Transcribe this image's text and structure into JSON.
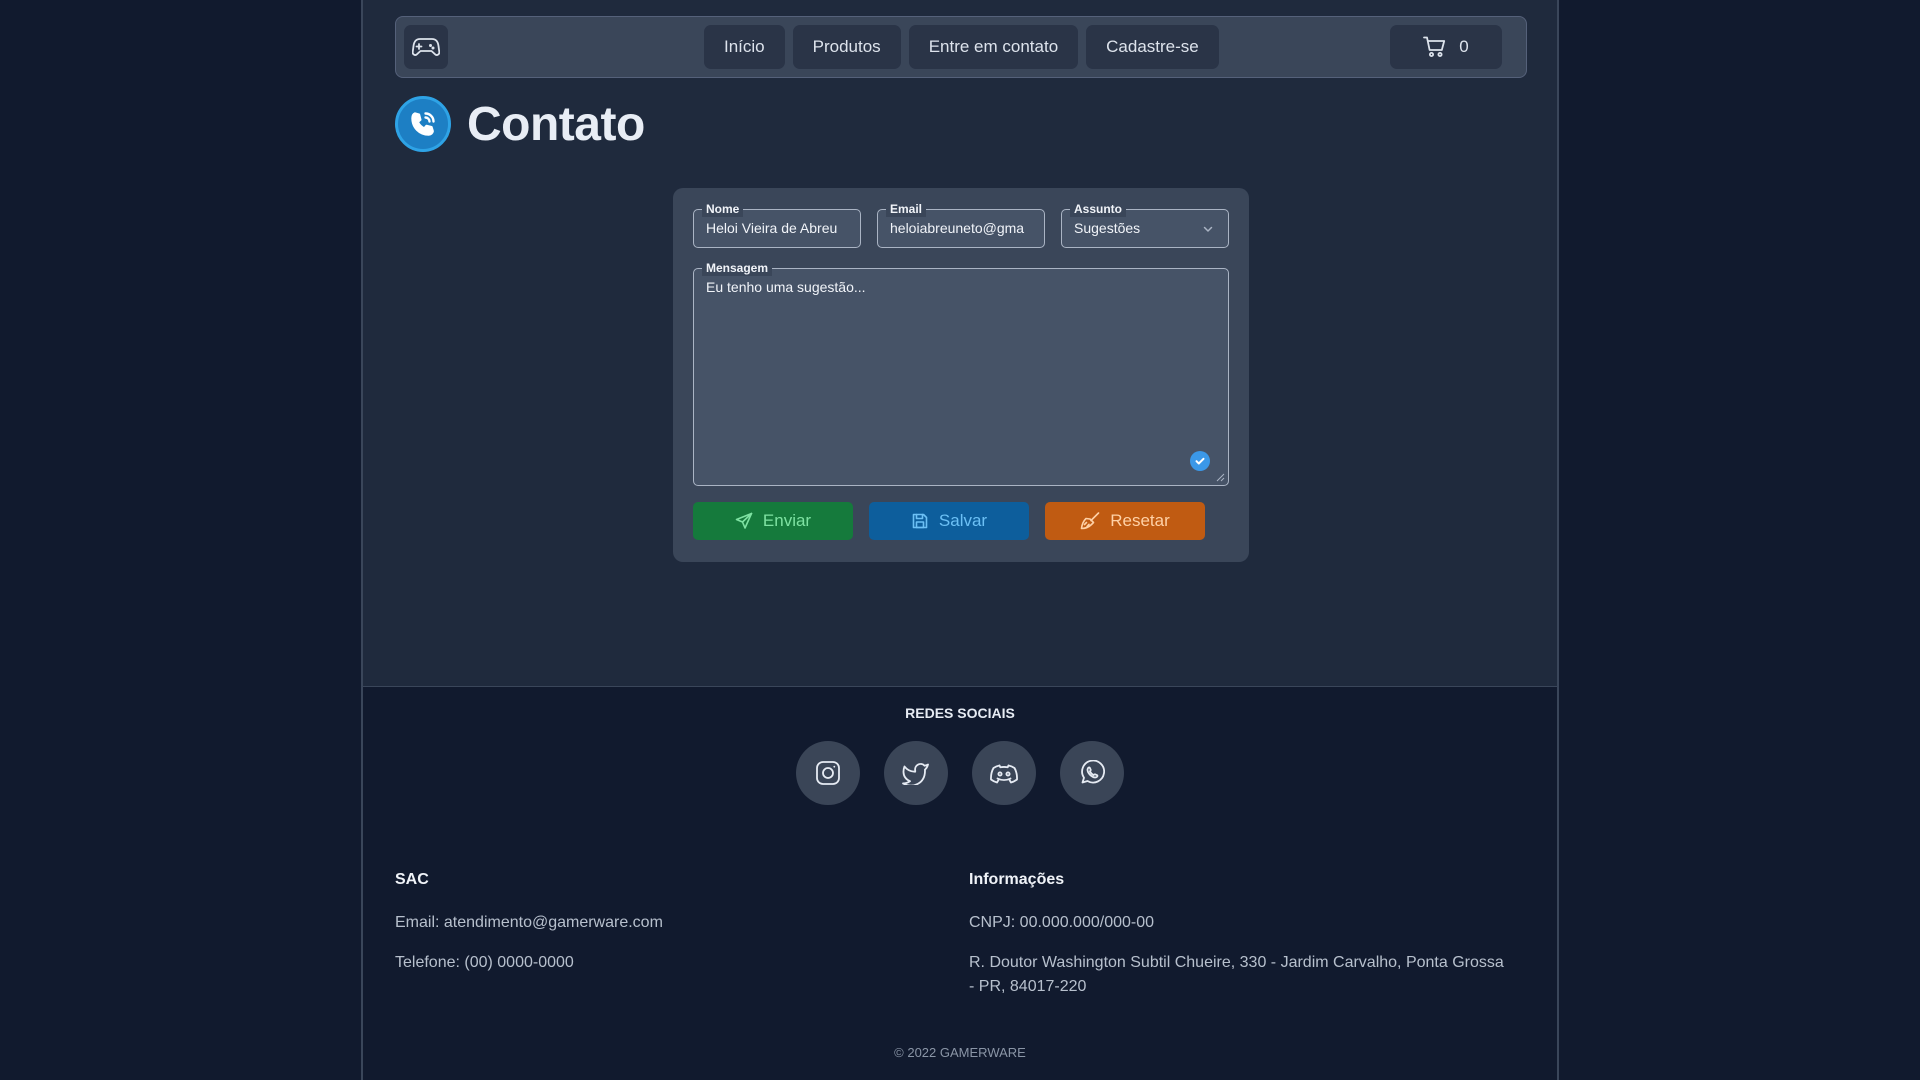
{
  "navbar": {
    "logo_icon": "gamepad-icon",
    "links": [
      {
        "label": "Início"
      },
      {
        "label": "Produtos"
      },
      {
        "label": "Entre em contato"
      },
      {
        "label": "Cadastre-se"
      }
    ],
    "cart": {
      "icon": "cart-icon",
      "count": "0"
    }
  },
  "page": {
    "title": "Contato",
    "title_icon": "phone-icon"
  },
  "form": {
    "nome": {
      "label": "Nome",
      "value": "Heloi Vieira de Abreu"
    },
    "email": {
      "label": "Email",
      "value": "heloiabreuneto@gma"
    },
    "assunto": {
      "label": "Assunto",
      "value": "Sugestões"
    },
    "mensagem": {
      "label": "Mensagem",
      "value": "Eu tenho uma sugestão..."
    },
    "buttons": {
      "enviar": "Enviar",
      "salvar": "Salvar",
      "resetar": "Resetar"
    }
  },
  "footer": {
    "social_title": "REDES SOCIAIS",
    "social": [
      "instagram-icon",
      "twitter-icon",
      "discord-icon",
      "whatsapp-icon"
    ],
    "sac": {
      "title": "SAC",
      "email": "Email: atendimento@gamerware.com",
      "telefone": "Telefone: (00) 0000-0000"
    },
    "info": {
      "title": "Informações",
      "cnpj": "CNPJ: 00.000.000/000-00",
      "address": "R. Doutor Washington Subtil Chueire, 330 - Jardim Carvalho, Ponta Grossa - PR, 84017-220"
    },
    "copyright": "© 2022 GAMERWARE"
  },
  "colors": {
    "background": "#111a2e",
    "page": "#1f2a3d",
    "card": "#3a4659",
    "enviar": "#157a3c",
    "salvar": "#0d5e9c",
    "resetar": "#c05b12",
    "accent": "#1d7fc4"
  }
}
